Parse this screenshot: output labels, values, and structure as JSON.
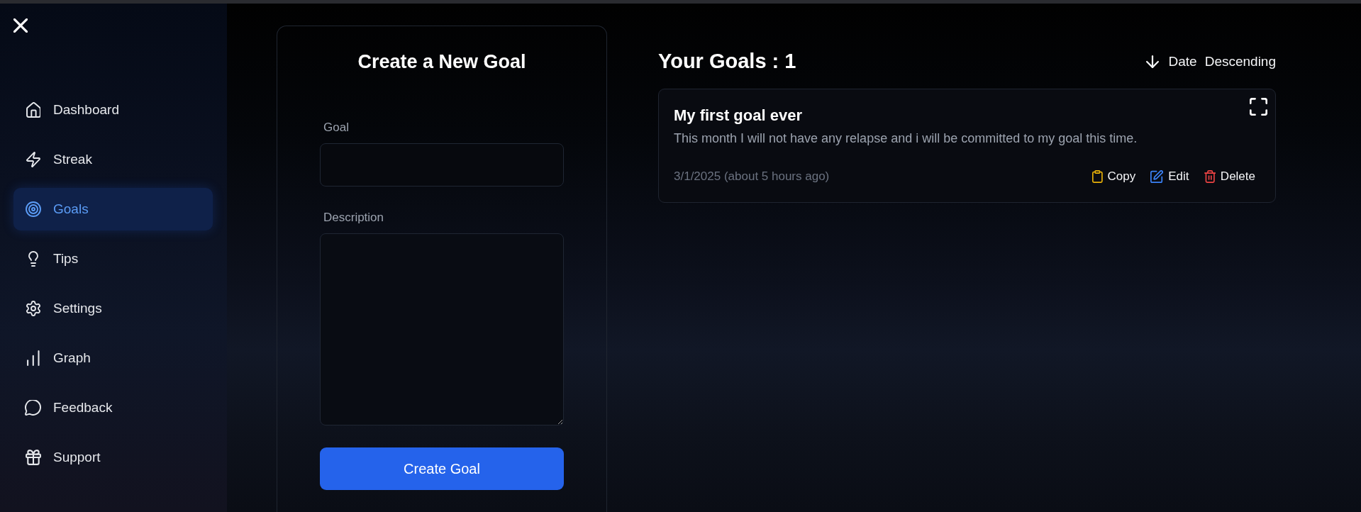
{
  "sidebar": {
    "items": [
      {
        "label": "Dashboard",
        "selected": false
      },
      {
        "label": "Streak",
        "selected": false
      },
      {
        "label": "Goals",
        "selected": true
      },
      {
        "label": "Tips",
        "selected": false
      },
      {
        "label": "Settings",
        "selected": false
      },
      {
        "label": "Graph",
        "selected": false
      },
      {
        "label": "Feedback",
        "selected": false
      },
      {
        "label": "Support",
        "selected": false
      }
    ]
  },
  "form": {
    "title": "Create a New Goal",
    "fields": [
      {
        "label": "Goal",
        "kind": "input"
      },
      {
        "label": "Description",
        "kind": "textarea"
      }
    ],
    "submit": "Create Goal"
  },
  "goals": {
    "title": "Your Goals : 1",
    "sort": {
      "field": "Date",
      "order": "Descending"
    },
    "items": [
      {
        "title": "My first goal ever",
        "description": "This month I will not have any relapse and i will be committed to my goal this time.",
        "date": "3/1/2025 (about 5 hours ago)",
        "actions": [
          {
            "label": "Copy",
            "kind": "copy"
          },
          {
            "label": "Edit",
            "kind": "edit"
          },
          {
            "label": "Delete",
            "kind": "delete"
          }
        ]
      }
    ]
  }
}
